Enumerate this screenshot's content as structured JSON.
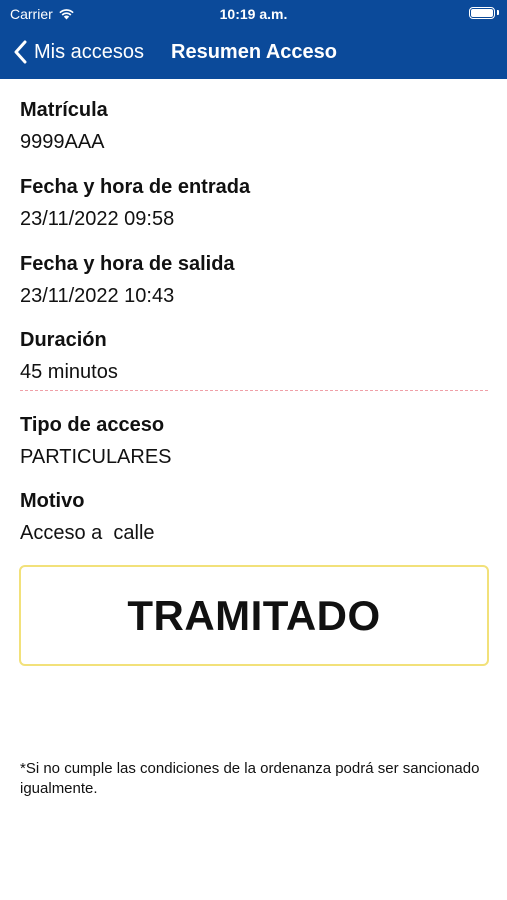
{
  "status_bar": {
    "carrier": "Carrier",
    "time": "10:19 a.m."
  },
  "nav": {
    "back_label": "Mis accesos",
    "title": "Resumen Acceso"
  },
  "fields": [
    {
      "label": "Matrícula",
      "value": "9999AAA"
    },
    {
      "label": "Fecha y hora de entrada",
      "value": "23/11/2022 09:58"
    },
    {
      "label": "Fecha y hora de salida",
      "value": "23/11/2022 10:43"
    },
    {
      "label": "Duración",
      "value": "45 minutos"
    },
    {
      "label": "Tipo de acceso",
      "value": "PARTICULARES"
    },
    {
      "label": "Motivo",
      "value": "Acceso a  calle"
    }
  ],
  "status": {
    "text": "TRAMITADO",
    "border_color": "#f2e17a"
  },
  "footnote": "*Si no cumple las condiciones de la ordenanza podrá ser sancionado igualmente.",
  "colors": {
    "header_bg": "#0b4a9a",
    "divider": "#f0a0a8"
  }
}
